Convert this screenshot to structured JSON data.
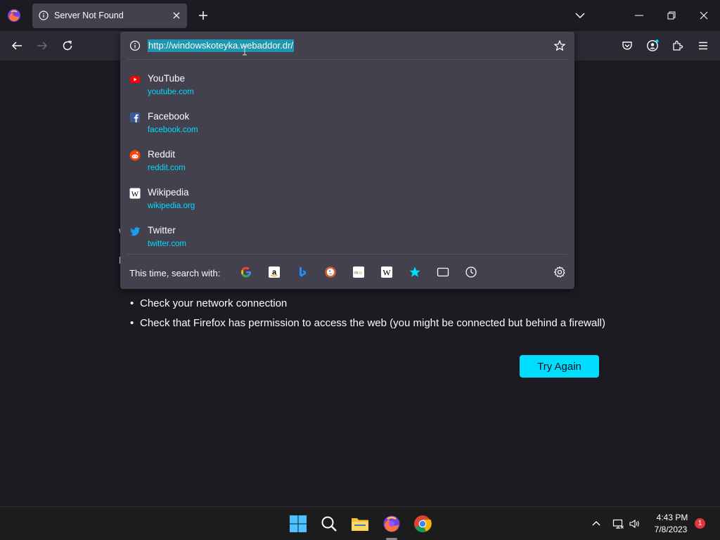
{
  "tab": {
    "title": "Server Not Found"
  },
  "urlbar": {
    "value": "http://windowskoteyka.webaddor.dr/"
  },
  "suggestions": [
    {
      "title": "YouTube",
      "url": "youtube.com",
      "icon": "youtube-icon"
    },
    {
      "title": "Facebook",
      "url": "facebook.com",
      "icon": "facebook-icon"
    },
    {
      "title": "Reddit",
      "url": "reddit.com",
      "icon": "reddit-icon"
    },
    {
      "title": "Wikipedia",
      "url": "wikipedia.org",
      "icon": "wikipedia-icon"
    },
    {
      "title": "Twitter",
      "url": "twitter.com",
      "icon": "twitter-icon"
    }
  ],
  "search_with": {
    "label": "This time, search with:",
    "engines": [
      "google-icon",
      "amazon-icon",
      "bing-icon",
      "duckduckgo-icon",
      "ebay-icon",
      "wikipedia-icon",
      "bookmarks-icon",
      "tabs-icon",
      "history-icon"
    ]
  },
  "page": {
    "bullets": [
      "Check your network connection",
      "Check that Firefox has permission to access the web (you might be connected but behind a firewall)"
    ],
    "try_again_label": "Try Again"
  },
  "taskbar": {
    "time": "4:43 PM",
    "date": "7/8/2023",
    "notification_count": "1"
  },
  "colors": {
    "accent": "#00ddff",
    "page_bg": "#1c1b22",
    "toolbar_bg": "#2b2a33",
    "popup_bg": "#42414d"
  }
}
